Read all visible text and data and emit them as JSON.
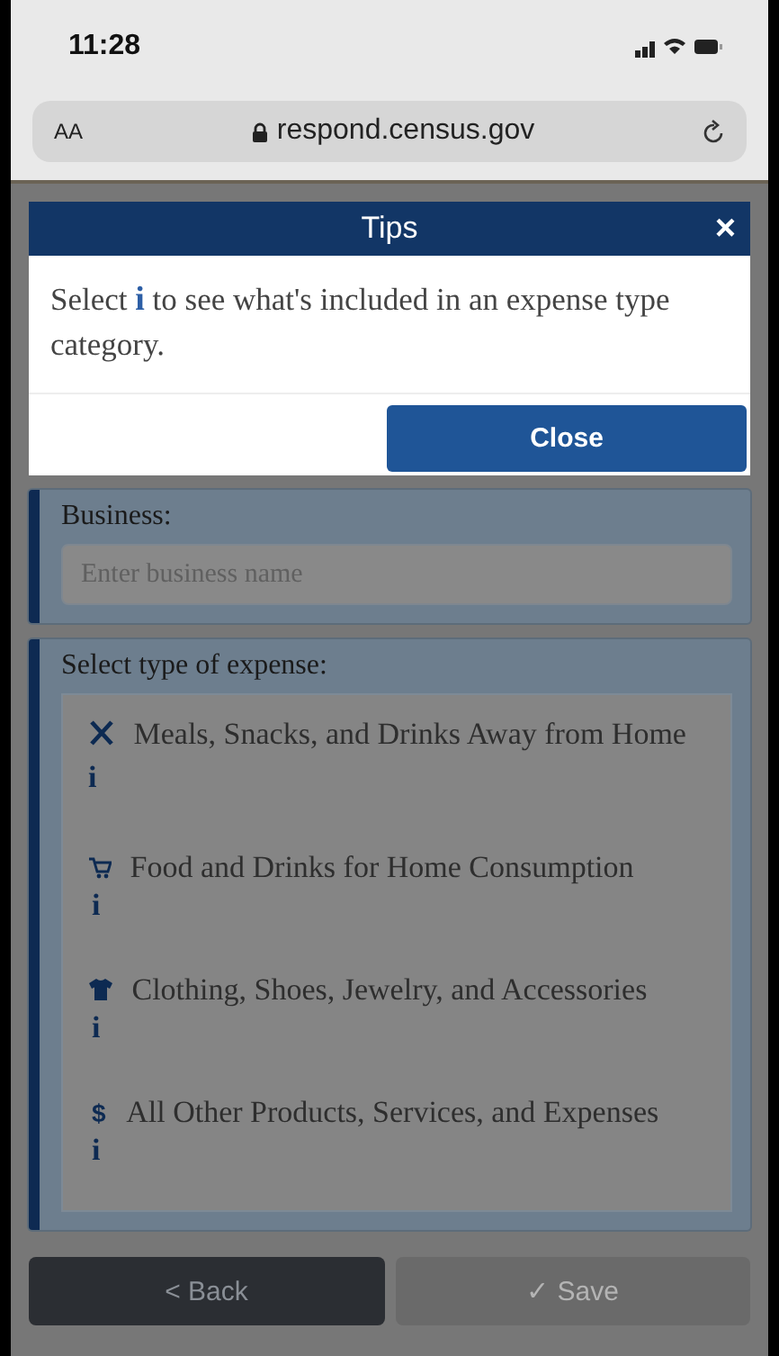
{
  "status_bar": {
    "time": "11:28"
  },
  "browser": {
    "text_size": "AA",
    "url": "respond.census.gov"
  },
  "tips_dialog": {
    "title": "Tips",
    "close_x": "×",
    "tip": {
      "before": "Select",
      "icon": "i",
      "after": "to see what's included in an expense type category."
    },
    "close_button": "Close"
  },
  "business": {
    "label": "Business:",
    "placeholder": "Enter business name"
  },
  "expense": {
    "label": "Select type of expense:",
    "options": [
      {
        "kind": "meals",
        "text": "Meals, Snacks, and Drinks Away from Home",
        "info": "i"
      },
      {
        "kind": "food",
        "text": "Food and Drinks for Home Consumption",
        "info": "i"
      },
      {
        "kind": "clothing",
        "text": "Clothing, Shoes, Jewelry, and Accessories",
        "info": "i"
      },
      {
        "kind": "other",
        "symbol": "$",
        "text": "All Other Products, Services, and Expenses",
        "info": "i"
      }
    ]
  },
  "buttons": {
    "back": {
      "label": "< Back",
      "disabled": false
    },
    "save": {
      "label": "✓ Save",
      "disabled": true
    }
  }
}
